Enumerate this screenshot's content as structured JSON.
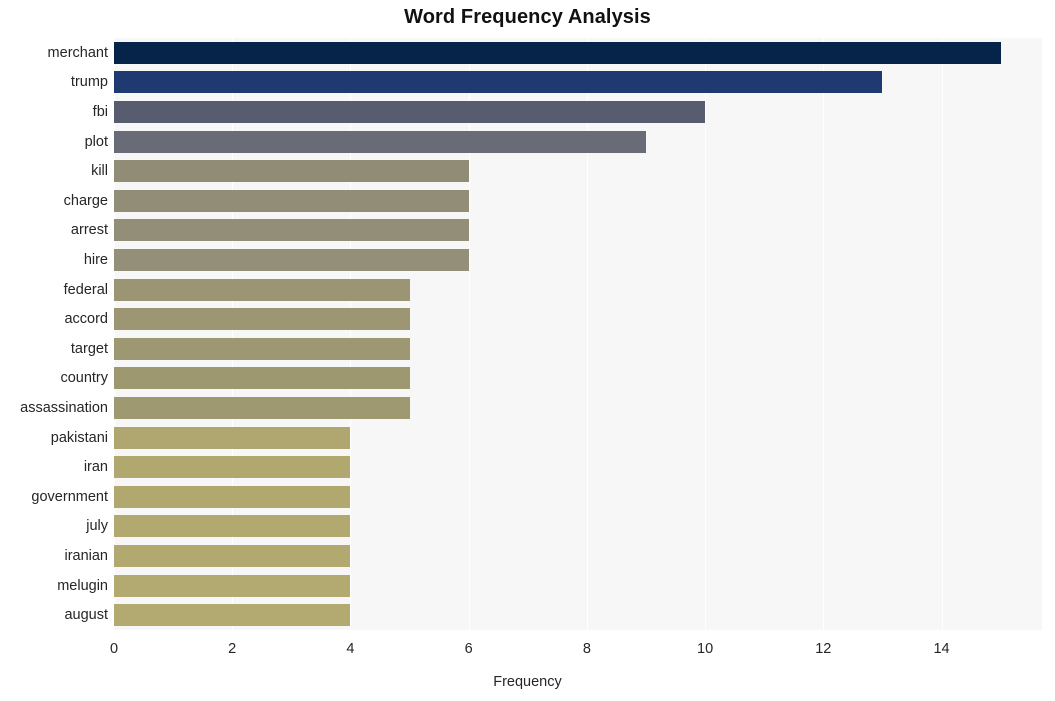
{
  "chart_data": {
    "type": "bar",
    "orientation": "horizontal",
    "title": "Word Frequency Analysis",
    "xlabel": "Frequency",
    "ylabel": "",
    "categories": [
      "merchant",
      "trump",
      "fbi",
      "plot",
      "kill",
      "charge",
      "arrest",
      "hire",
      "federal",
      "accord",
      "target",
      "country",
      "assassination",
      "pakistani",
      "iran",
      "government",
      "july",
      "iranian",
      "melugin",
      "august"
    ],
    "values": [
      15,
      13,
      10,
      9,
      6,
      6,
      6,
      6,
      5,
      5,
      5,
      5,
      5,
      4,
      4,
      4,
      4,
      4,
      4,
      4
    ],
    "xlim": [
      0,
      15.7
    ],
    "ylim": [
      0,
      20
    ],
    "xticks": [
      0,
      2,
      4,
      6,
      8,
      10,
      12,
      14
    ],
    "xtick_labels": [
      "0",
      "2",
      "4",
      "6",
      "8",
      "10",
      "12",
      "14"
    ],
    "grid": "vertical-only",
    "legend": "none",
    "bar_colors": [
      "#062449",
      "#1f3a70",
      "#575c6f",
      "#696c77",
      "#908c75",
      "#918d76",
      "#928e77",
      "#938f78",
      "#9b9573",
      "#9c9672",
      "#9d9772",
      "#9e9871",
      "#9f9971",
      "#b0a770",
      "#b1a870",
      "#b1a870",
      "#b2a971",
      "#b2a971",
      "#b3aa71",
      "#b3aa71"
    ],
    "plot_background": "#f7f7f8",
    "figure_background": "#ffffff",
    "gridline_color": "#ffffff",
    "text_color": "#262626"
  }
}
